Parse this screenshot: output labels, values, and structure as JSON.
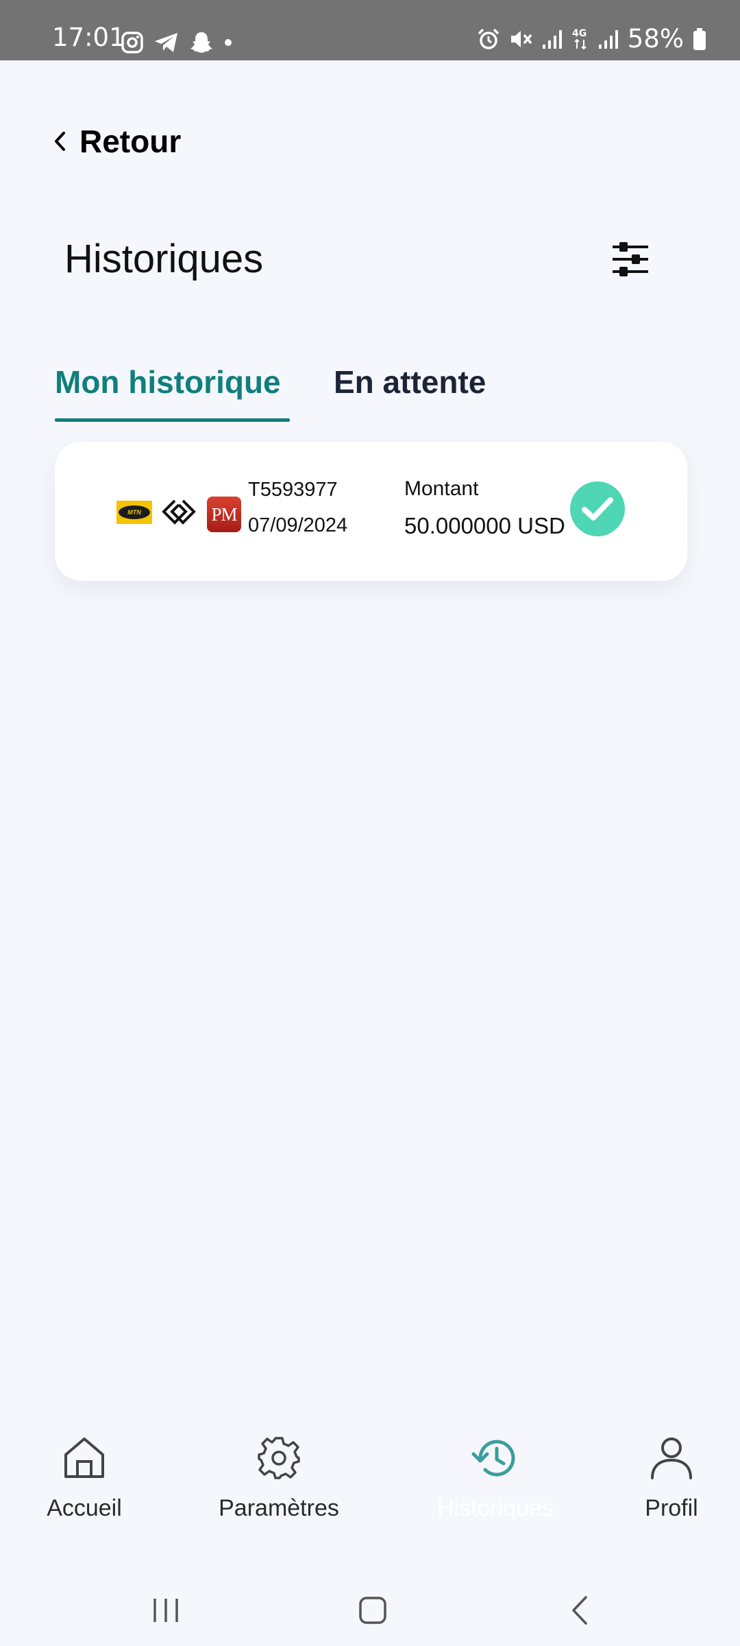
{
  "status_bar": {
    "time": "17:01",
    "battery": "58%",
    "left_icons": [
      "instagram-icon",
      "telegram-icon",
      "snapchat-icon",
      "dot-icon"
    ],
    "right_icons": [
      "alarm-icon",
      "mute-icon",
      "signal-icon",
      "4g-icon",
      "signal-icon",
      "battery-icon"
    ]
  },
  "header": {
    "back_label": "Retour",
    "title": "Historiques"
  },
  "tabs": [
    {
      "label": "Mon historique",
      "active": true
    },
    {
      "label": "En attente",
      "active": false
    }
  ],
  "transactions": [
    {
      "source_logo": "MTN",
      "target_logo": "PM",
      "id": "T5593977",
      "date": "07/09/2024",
      "amount_label": "Montant",
      "amount": "50.000000 USD",
      "status": "success"
    }
  ],
  "bottom_nav": [
    {
      "label": "Accueil",
      "icon": "home-icon",
      "active": false
    },
    {
      "label": "Paramètres",
      "icon": "gear-icon",
      "active": false
    },
    {
      "label": "Historiques",
      "icon": "history-icon",
      "active": true
    },
    {
      "label": "Profil",
      "icon": "user-icon",
      "active": false
    }
  ],
  "colors": {
    "accent": "#0f7f7c",
    "success": "#4fd6b4",
    "background": "#f6f7fc",
    "status_bar": "#737373"
  }
}
